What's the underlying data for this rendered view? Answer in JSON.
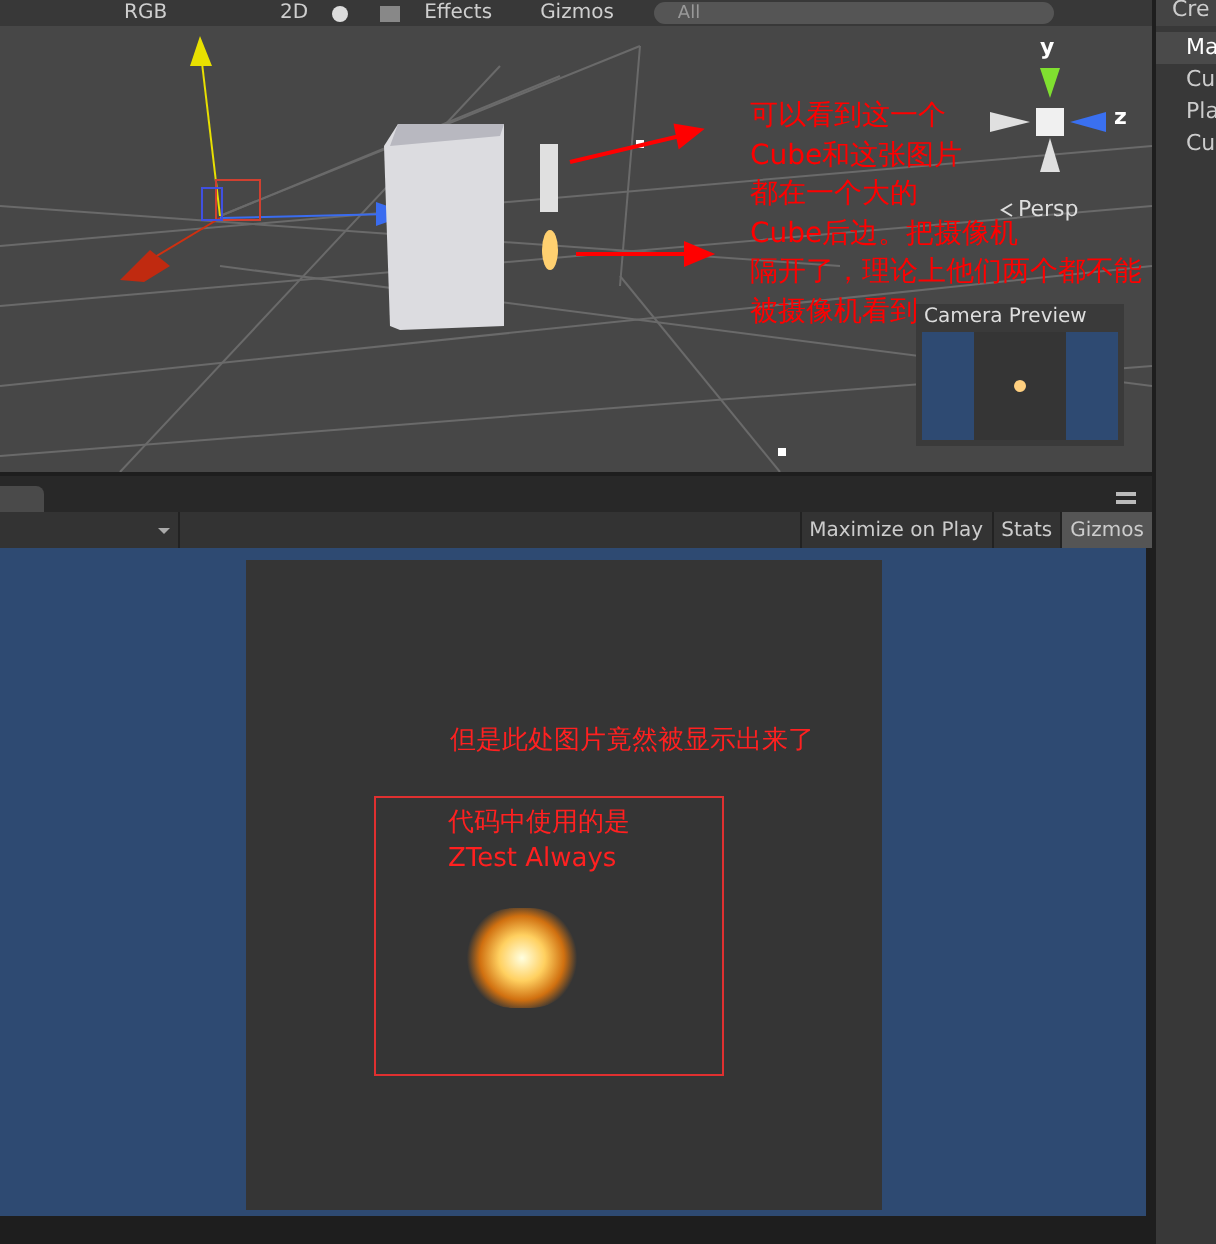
{
  "scene_toolbar": {
    "draw_mode": "RGB",
    "mode_2d": "2D",
    "effects": "Effects",
    "gizmos": "Gizmos",
    "search": {
      "placeholder": "All"
    }
  },
  "scene": {
    "axis_y": "y",
    "axis_z": "z",
    "projection": "Persp",
    "annotation": [
      "可以看到这一个",
      "Cube和这张图片",
      "都在一个大的",
      "Cube后边。把摄像机",
      "隔开了，理论上他们两个都不能",
      "被摄像机看到"
    ],
    "camera_preview": {
      "title": "Camera Preview"
    }
  },
  "hierarchy": {
    "create": "Cre",
    "items": [
      {
        "label": "Ma",
        "selected": true
      },
      {
        "label": "Cu",
        "selected": false
      },
      {
        "label": "Pla",
        "selected": false
      },
      {
        "label": "Cu",
        "selected": false
      }
    ]
  },
  "game_toolbar": {
    "buttons": [
      {
        "label": "Maximize on Play",
        "selected": false
      },
      {
        "label": "Stats",
        "selected": false
      },
      {
        "label": "Gizmos",
        "selected": true
      }
    ]
  },
  "game": {
    "note": "但是此处图片竟然被显示出来了",
    "box_note": [
      "代码中使用的是",
      "ZTest Always"
    ]
  }
}
